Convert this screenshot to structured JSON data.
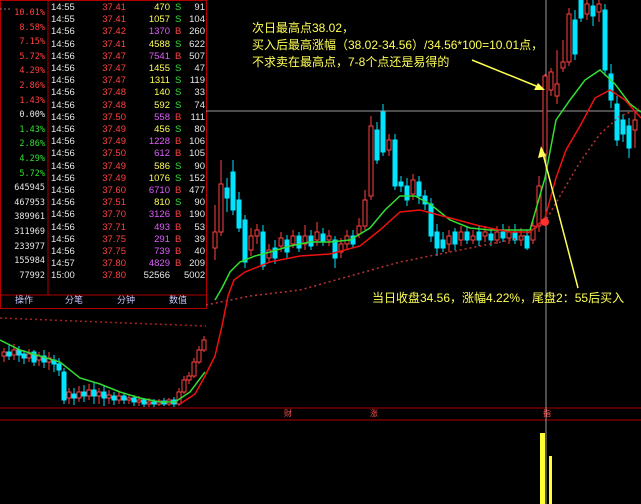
{
  "scale_ticks": [
    {
      "label": "10.01%",
      "color": "#ff4040"
    },
    {
      "label": "8.58%",
      "color": "#ff4040"
    },
    {
      "label": "7.15%",
      "color": "#ff4040"
    },
    {
      "label": "5.72%",
      "color": "#ff4040"
    },
    {
      "label": "4.29%",
      "color": "#ff4040"
    },
    {
      "label": "2.86%",
      "color": "#ff4040"
    },
    {
      "label": "1.43%",
      "color": "#ff4040"
    },
    {
      "label": "0.00%",
      "color": "#e6e6e6"
    },
    {
      "label": "1.43%",
      "color": "#2ee02e"
    },
    {
      "label": "2.86%",
      "color": "#2ee02e"
    },
    {
      "label": "4.29%",
      "color": "#2ee02e"
    },
    {
      "label": "5.72%",
      "color": "#2ee02e"
    },
    {
      "label": "645945",
      "color": "#e6e6e6"
    },
    {
      "label": "467953",
      "color": "#e6e6e6"
    },
    {
      "label": "389961",
      "color": "#e6e6e6"
    },
    {
      "label": "311969",
      "color": "#e6e6e6"
    },
    {
      "label": "233977",
      "color": "#e6e6e6"
    },
    {
      "label": "155984",
      "color": "#e6e6e6"
    },
    {
      "label": "77992",
      "color": "#e6e6e6"
    }
  ],
  "trades": [
    {
      "time": "14:55",
      "price": "37.41",
      "vol": "470",
      "side": "S",
      "count": "91"
    },
    {
      "time": "14:55",
      "price": "37.41",
      "vol": "1057",
      "side": "S",
      "count": "104"
    },
    {
      "time": "14:56",
      "price": "37.42",
      "vol": "1370",
      "side": "B",
      "count": "260"
    },
    {
      "time": "14:56",
      "price": "37.41",
      "vol": "4588",
      "side": "S",
      "count": "622"
    },
    {
      "time": "14:56",
      "price": "37.47",
      "vol": "7541",
      "side": "B",
      "count": "507"
    },
    {
      "time": "14:56",
      "price": "37.47",
      "vol": "1455",
      "side": "S",
      "count": "47"
    },
    {
      "time": "14:56",
      "price": "37.47",
      "vol": "1311",
      "side": "S",
      "count": "119"
    },
    {
      "time": "14:56",
      "price": "37.48",
      "vol": "140",
      "side": "S",
      "count": "33"
    },
    {
      "time": "14:56",
      "price": "37.48",
      "vol": "592",
      "side": "S",
      "count": "74"
    },
    {
      "time": "14:56",
      "price": "37.50",
      "vol": "558",
      "side": "B",
      "count": "111"
    },
    {
      "time": "14:56",
      "price": "37.49",
      "vol": "456",
      "side": "S",
      "count": "80"
    },
    {
      "time": "14:56",
      "price": "37.49",
      "vol": "1228",
      "side": "B",
      "count": "106"
    },
    {
      "time": "14:56",
      "price": "37.50",
      "vol": "612",
      "side": "B",
      "count": "105"
    },
    {
      "time": "14:56",
      "price": "37.49",
      "vol": "586",
      "side": "S",
      "count": "90"
    },
    {
      "time": "14:56",
      "price": "37.49",
      "vol": "1076",
      "side": "S",
      "count": "152"
    },
    {
      "time": "14:56",
      "price": "37.60",
      "vol": "6710",
      "side": "B",
      "count": "477"
    },
    {
      "time": "14:56",
      "price": "37.51",
      "vol": "810",
      "side": "S",
      "count": "90"
    },
    {
      "time": "14:56",
      "price": "37.70",
      "vol": "3126",
      "side": "B",
      "count": "190"
    },
    {
      "time": "14:56",
      "price": "37.71",
      "vol": "493",
      "side": "B",
      "count": "53"
    },
    {
      "time": "14:56",
      "price": "37.75",
      "vol": "291",
      "side": "B",
      "count": "39"
    },
    {
      "time": "14:56",
      "price": "37.75",
      "vol": "739",
      "side": "B",
      "count": "40"
    },
    {
      "time": "14:57",
      "price": "37.80",
      "vol": "4829",
      "side": "B",
      "count": "209"
    },
    {
      "time": "15:00",
      "price": "37.80",
      "vol": "52566",
      "side": "",
      "count": "5002"
    }
  ],
  "tabs": [
    "操作",
    "分笔",
    "分钟",
    "数值"
  ],
  "annotations": {
    "top": [
      "次日最高点38.02，",
      "买入后最高涨幅（38.02-34.56）/34.56*100=10.01点，",
      "不求卖在最高点，7-8个点还是易得的"
    ],
    "bottom": "当日收盘34.56，涨幅4.22%，尾盘2：55后买入"
  },
  "markers": [
    "财",
    "涨",
    "指"
  ],
  "colors": {
    "up": "#ff4040",
    "down": "#00e5ff",
    "ma_green": "#33dd33",
    "ma_red": "#ee1111",
    "annotation": "#ffff55",
    "border": "#b00000"
  }
}
